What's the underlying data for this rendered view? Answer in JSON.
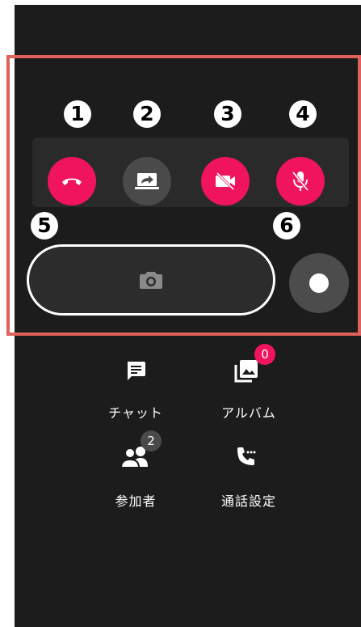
{
  "controls": {
    "end_call": {
      "number": "1",
      "icon": "phone-hangup-icon"
    },
    "screen_share": {
      "number": "2",
      "icon": "screen-share-icon"
    },
    "video_off": {
      "number": "3",
      "icon": "video-off-icon"
    },
    "mic_mute": {
      "number": "4",
      "icon": "mic-off-icon"
    },
    "camera_capture": {
      "number": "5",
      "icon": "camera-icon"
    },
    "record": {
      "number": "6",
      "icon": "record-icon"
    }
  },
  "menu": {
    "chat": {
      "label": "チャット",
      "icon": "chat-icon"
    },
    "album": {
      "label": "アルバム",
      "icon": "album-icon",
      "badge": "0"
    },
    "participants": {
      "label": "参加者",
      "icon": "participants-icon",
      "badge": "2"
    },
    "call_settings": {
      "label": "通話設定",
      "icon": "call-settings-icon"
    }
  },
  "colors": {
    "accent": "#f0145f",
    "highlight_border": "#e0605c",
    "background": "#1c1c1c",
    "button_gray": "#4a4a4a"
  }
}
